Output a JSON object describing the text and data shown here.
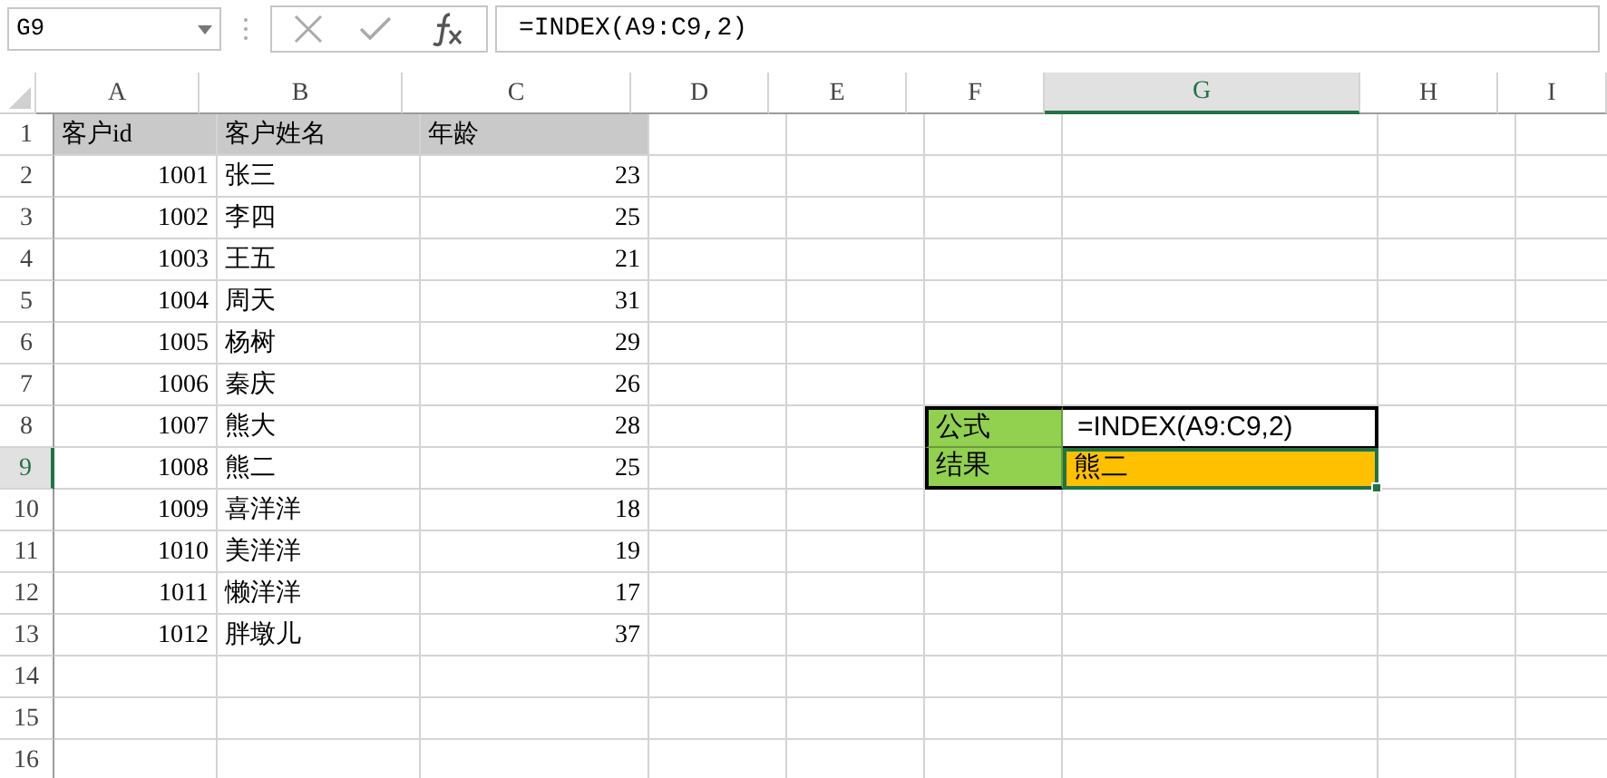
{
  "name_box": "G9",
  "formula": "=INDEX(A9:C9,2)",
  "columns": [
    {
      "label": "A",
      "selected": false
    },
    {
      "label": "B",
      "selected": false
    },
    {
      "label": "C",
      "selected": false
    },
    {
      "label": "D",
      "selected": false
    },
    {
      "label": "E",
      "selected": false
    },
    {
      "label": "F",
      "selected": false
    },
    {
      "label": "G",
      "selected": true
    },
    {
      "label": "H",
      "selected": false
    },
    {
      "label": "I",
      "selected": false
    }
  ],
  "rows": [
    {
      "label": "1",
      "selected": false,
      "cells": [
        {
          "text": "客户id",
          "kind": "header"
        },
        {
          "text": "客户姓名",
          "kind": "header"
        },
        {
          "text": "年龄",
          "kind": "header"
        }
      ]
    },
    {
      "label": "2",
      "selected": false,
      "cells": [
        {
          "text": "1001",
          "kind": "number"
        },
        {
          "text": "张三",
          "kind": "text"
        },
        {
          "text": "23",
          "kind": "number"
        }
      ]
    },
    {
      "label": "3",
      "selected": false,
      "cells": [
        {
          "text": "1002",
          "kind": "number"
        },
        {
          "text": "李四",
          "kind": "text"
        },
        {
          "text": "25",
          "kind": "number"
        }
      ]
    },
    {
      "label": "4",
      "selected": false,
      "cells": [
        {
          "text": "1003",
          "kind": "number"
        },
        {
          "text": "王五",
          "kind": "text"
        },
        {
          "text": "21",
          "kind": "number"
        }
      ]
    },
    {
      "label": "5",
      "selected": false,
      "cells": [
        {
          "text": "1004",
          "kind": "number"
        },
        {
          "text": "周天",
          "kind": "text"
        },
        {
          "text": "31",
          "kind": "number"
        }
      ]
    },
    {
      "label": "6",
      "selected": false,
      "cells": [
        {
          "text": "1005",
          "kind": "number"
        },
        {
          "text": "杨树",
          "kind": "text"
        },
        {
          "text": "29",
          "kind": "number"
        }
      ]
    },
    {
      "label": "7",
      "selected": false,
      "cells": [
        {
          "text": "1006",
          "kind": "number"
        },
        {
          "text": "秦庆",
          "kind": "text"
        },
        {
          "text": "26",
          "kind": "number"
        }
      ]
    },
    {
      "label": "8",
      "selected": false,
      "cells": [
        {
          "text": "1007",
          "kind": "number"
        },
        {
          "text": "熊大",
          "kind": "text"
        },
        {
          "text": "28",
          "kind": "number"
        }
      ]
    },
    {
      "label": "9",
      "selected": true,
      "cells": [
        {
          "text": "1008",
          "kind": "number"
        },
        {
          "text": "熊二",
          "kind": "text"
        },
        {
          "text": "25",
          "kind": "number"
        }
      ]
    },
    {
      "label": "10",
      "selected": false,
      "cells": [
        {
          "text": "1009",
          "kind": "number"
        },
        {
          "text": "喜洋洋",
          "kind": "text"
        },
        {
          "text": "18",
          "kind": "number"
        }
      ]
    },
    {
      "label": "11",
      "selected": false,
      "cells": [
        {
          "text": "1010",
          "kind": "number"
        },
        {
          "text": "美洋洋",
          "kind": "text"
        },
        {
          "text": "19",
          "kind": "number"
        }
      ]
    },
    {
      "label": "12",
      "selected": false,
      "cells": [
        {
          "text": "1011",
          "kind": "number"
        },
        {
          "text": "懒洋洋",
          "kind": "text"
        },
        {
          "text": "17",
          "kind": "number"
        }
      ]
    },
    {
      "label": "13",
      "selected": false,
      "cells": [
        {
          "text": "1012",
          "kind": "number"
        },
        {
          "text": "胖墩儿",
          "kind": "text"
        },
        {
          "text": "37",
          "kind": "number"
        }
      ]
    },
    {
      "label": "14",
      "selected": false,
      "cells": []
    },
    {
      "label": "15",
      "selected": false,
      "cells": []
    },
    {
      "label": "16",
      "selected": false,
      "cells": []
    }
  ],
  "lookup_table": [
    {
      "label": "公式",
      "value": "=INDEX(A9:C9,2)",
      "kind": "formula",
      "selected": false
    },
    {
      "label": "结果",
      "value": "熊二",
      "kind": "result",
      "selected": true
    }
  ]
}
